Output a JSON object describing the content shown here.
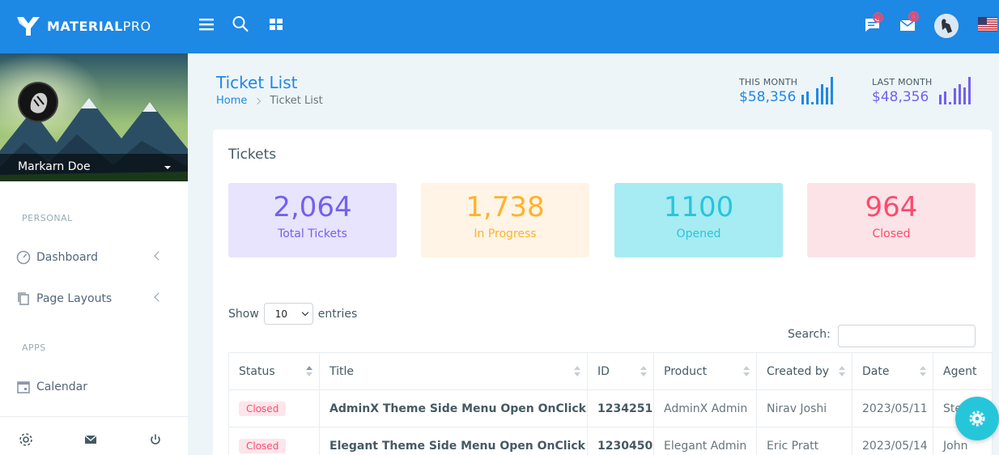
{
  "brand": {
    "name_bold": "MATERIAL",
    "name_light": "PRO"
  },
  "profile": {
    "name": "Markarn Doe"
  },
  "nav": {
    "caption_personal": "PERSONAL",
    "dashboard": "Dashboard",
    "page_layouts": "Page Layouts",
    "caption_apps": "APPS",
    "calendar": "Calendar"
  },
  "page": {
    "title": "Ticket List",
    "breadcrumb_home": "Home",
    "breadcrumb_current": "Ticket List"
  },
  "stats": {
    "this_month": {
      "caption": "THIS MONTH",
      "amount": "$58,356",
      "color": "#1e88e5"
    },
    "last_month": {
      "caption": "LAST MONTH",
      "amount": "$48,356",
      "color": "#7460ee"
    }
  },
  "card": {
    "title": "Tickets"
  },
  "summary": {
    "total": {
      "value": "2,064",
      "label": "Total Tickets",
      "bg": "#e8e4fd",
      "color": "#7460ee"
    },
    "progress": {
      "value": "1,738",
      "label": "In Progress",
      "bg": "#fff4e5",
      "color": "#ffb22b"
    },
    "opened": {
      "value": "1100",
      "label": "Opened",
      "bg": "#a7ebf3",
      "color": "#26c6da"
    },
    "closed": {
      "value": "964",
      "label": "Closed",
      "bg": "#fbe3e8",
      "color": "#fc4b6c"
    }
  },
  "table_controls": {
    "show_label": "Show",
    "entries_value": "10",
    "entries_label": "entries",
    "search_label": "Search:",
    "search_value": ""
  },
  "table": {
    "columns": [
      "Status",
      "Title",
      "ID",
      "Product",
      "Created by",
      "Date",
      "Agent"
    ],
    "rows": [
      [
        "Closed",
        "AdminX Theme Side Menu Open OnClick",
        "1234251",
        "AdminX Admin",
        "Nirav Joshi",
        "2023/05/11",
        "Steve"
      ],
      [
        "Closed",
        "Elegant Theme Side Menu Open OnClick",
        "1230450",
        "Elegant Admin",
        "Eric Pratt",
        "2023/05/14",
        "John"
      ]
    ]
  }
}
